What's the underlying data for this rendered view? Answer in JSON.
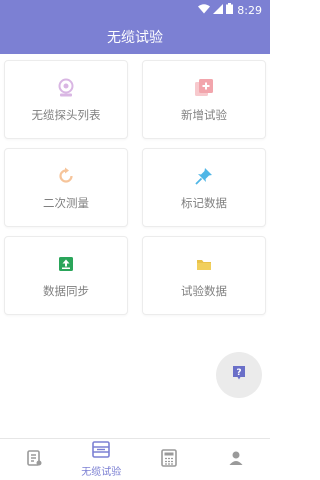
{
  "status_bar": {
    "time": "8:29"
  },
  "app_bar": {
    "title": "无缆试验"
  },
  "cards": [
    {
      "label": "无缆探头列表",
      "icon": "probe-icon",
      "color": "#d9b6e3"
    },
    {
      "label": "新增试验",
      "icon": "add-test-icon",
      "color": "#f2a5ac"
    },
    {
      "label": "二次测量",
      "icon": "refresh-icon",
      "color": "#f6c49a"
    },
    {
      "label": "标记数据",
      "icon": "pin-icon",
      "color": "#4fb6e6"
    },
    {
      "label": "数据同步",
      "icon": "sync-icon",
      "color": "#2aa55a"
    },
    {
      "label": "试验数据",
      "icon": "folder-icon",
      "color": "#e9c24a"
    }
  ],
  "bottom_nav": [
    {
      "icon": "document-icon",
      "label": ""
    },
    {
      "icon": "cable-test-icon",
      "label": "无缆试验"
    },
    {
      "icon": "calculator-icon",
      "label": ""
    },
    {
      "icon": "user-icon",
      "label": ""
    }
  ],
  "colors": {
    "primary": "#7c80d3",
    "fab_bg": "#ebebeb"
  }
}
